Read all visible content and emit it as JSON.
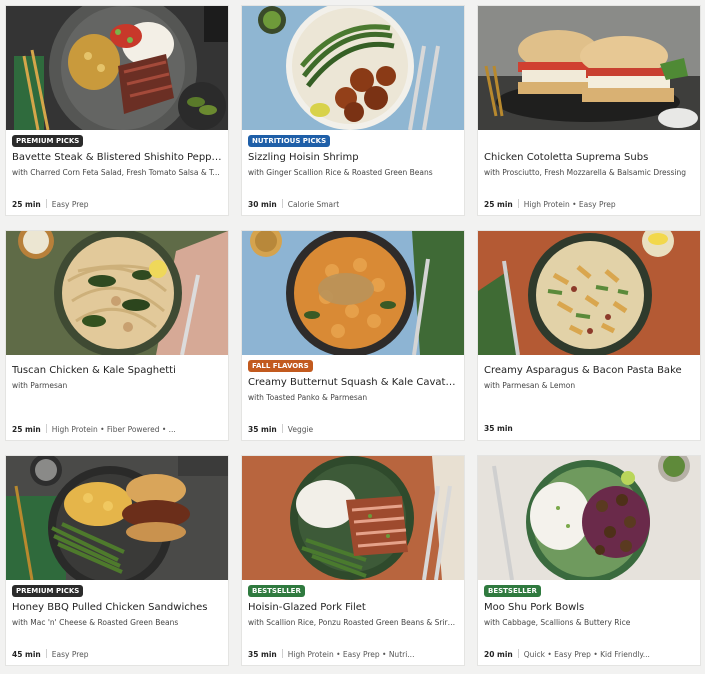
{
  "colors": {
    "badge_dark": "#2b2b2b",
    "badge_blue": "#1f5fa8",
    "badge_orange": "#c25a1e",
    "badge_green": "#2f7a3f"
  },
  "recipes": [
    {
      "badge": "PREMIUM PICKS",
      "title": "Bavette Steak & Blistered Shishito Peppers",
      "subtitle": "with Charred Corn Feta Salad, Fresh Tomato Salsa & Tortillas",
      "time": "25 min",
      "tags": "Easy Prep"
    },
    {
      "badge": "NUTRITIOUS PICKS",
      "title": "Sizzling Hoisin Shrimp",
      "subtitle": "with Ginger Scallion Rice & Roasted Green Beans",
      "time": "30 min",
      "tags": "Calorie Smart"
    },
    {
      "badge": "",
      "title": "Chicken Cotoletta Suprema Subs",
      "subtitle": "with Prosciutto, Fresh Mozzarella & Balsamic Dressing",
      "time": "25 min",
      "tags": "High Protein • Easy Prep"
    },
    {
      "badge": "",
      "title": "Tuscan Chicken & Kale Spaghetti",
      "subtitle": "with Parmesan",
      "time": "25 min",
      "tags": "High Protein • Fiber Powered • ..."
    },
    {
      "badge": "FALL FLAVORS",
      "title": "Creamy Butternut Squash & Kale Cavatappi",
      "subtitle": "with Toasted Panko & Parmesan",
      "time": "35 min",
      "tags": "Veggie"
    },
    {
      "badge": "",
      "title": "Creamy Asparagus & Bacon Pasta Bake",
      "subtitle": "with Parmesan & Lemon",
      "time": "35 min",
      "tags": ""
    },
    {
      "badge": "PREMIUM PICKS",
      "title": "Honey BBQ Pulled Chicken Sandwiches",
      "subtitle": "with Mac 'n' Cheese & Roasted Green Beans",
      "time": "45 min",
      "tags": "Easy Prep"
    },
    {
      "badge": "BESTSELLER",
      "title": "Hoisin-Glazed Pork Filet",
      "subtitle": "with Scallion Rice, Ponzu Roasted Green Beans & Sriracha Mayo",
      "time": "35 min",
      "tags": "High Protein • Easy Prep • Nutri..."
    },
    {
      "badge": "BESTSELLER",
      "title": "Moo Shu Pork Bowls",
      "subtitle": "with Cabbage, Scallions & Buttery Rice",
      "time": "20 min",
      "tags": "Quick • Easy Prep • Kid Friendly..."
    }
  ]
}
